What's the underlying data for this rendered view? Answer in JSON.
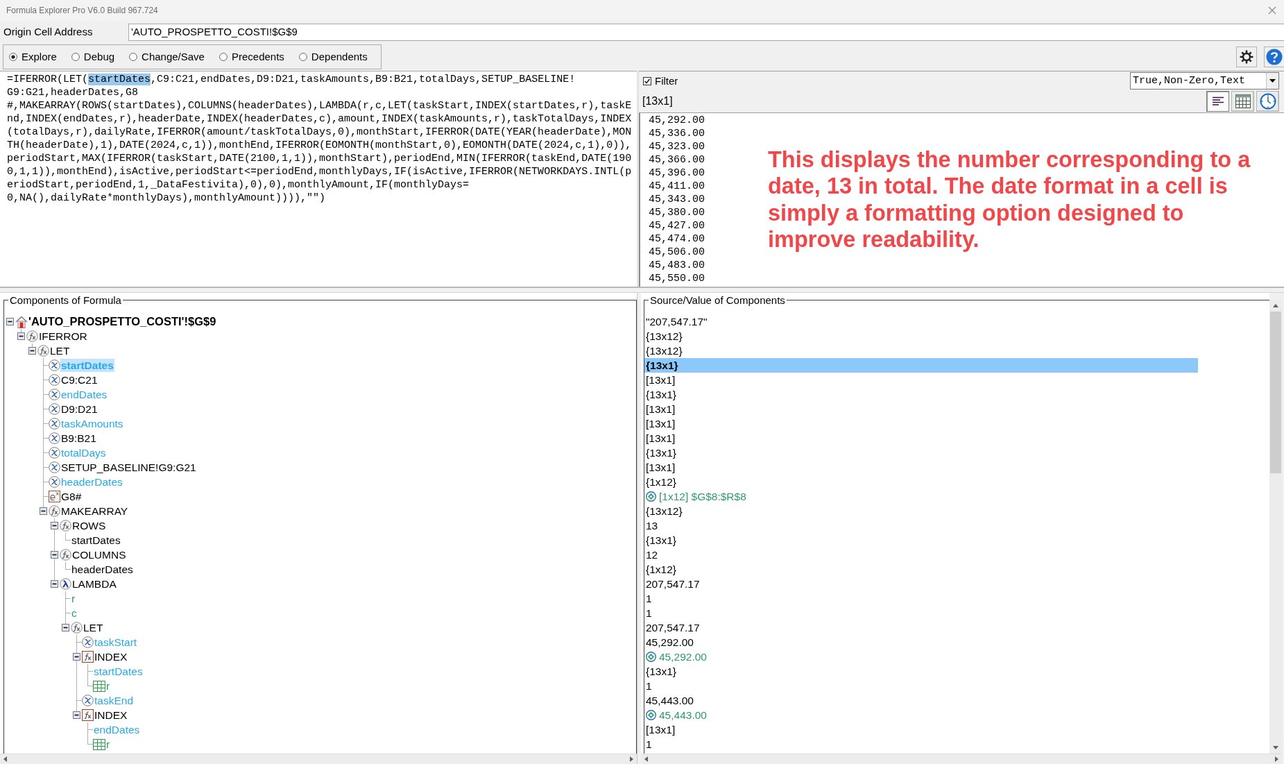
{
  "window": {
    "title": "Formula Explorer Pro V6.0 Build 967.724"
  },
  "origin": {
    "label": "Origin Cell Address",
    "value": "'AUTO_PROSPETTO_COSTI!$G$9"
  },
  "modes": [
    {
      "label": "Explore",
      "selected": true
    },
    {
      "label": "Debug",
      "selected": false
    },
    {
      "label": "Change/Save",
      "selected": false
    },
    {
      "label": "Precedents",
      "selected": false
    },
    {
      "label": "Dependents",
      "selected": false
    }
  ],
  "formula": {
    "lines": [
      {
        "segments": [
          {
            "text": "=IFERROR(LET(",
            "selected": false
          },
          {
            "text": "startDates",
            "selected": true
          },
          {
            "text": ",C9:C21,endDates,D9:D21,taskAmounts,B9:B21,totalDays,SETUP_BASELINE!",
            "selected": false
          }
        ]
      },
      {
        "segments": [
          {
            "text": "G9:G21,headerDates,G8",
            "selected": false
          }
        ]
      },
      {
        "segments": [
          {
            "text": "#,MAKEARRAY(ROWS(startDates),COLUMNS(headerDates),LAMBDA(r,c,LET(taskStart,INDEX(startDates,r),taskE",
            "selected": false
          }
        ]
      },
      {
        "segments": [
          {
            "text": "nd,INDEX(endDates,r),headerDate,INDEX(headerDates,c),amount,INDEX(taskAmounts,r),taskTotalDays,INDEX",
            "selected": false
          }
        ]
      },
      {
        "segments": [
          {
            "text": "(totalDays,r),dailyRate,IFERROR(amount/taskTotalDays,0),monthStart,IFERROR(DATE(YEAR(headerDate),MON",
            "selected": false
          }
        ]
      },
      {
        "segments": [
          {
            "text": "TH(headerDate),1),DATE(2024,c,1)),monthEnd,IFERROR(EOMONTH(monthStart,0),EOMONTH(DATE(2024,c,1),0)),",
            "selected": false
          }
        ]
      },
      {
        "segments": [
          {
            "text": "periodStart,MAX(IFERROR(taskStart,DATE(2100,1,1)),monthStart),periodEnd,MIN(IFERROR(taskEnd,DATE(190",
            "selected": false
          }
        ]
      },
      {
        "segments": [
          {
            "text": "0,1,1)),monthEnd),isActive,periodStart<=periodEnd,monthlyDays,IF(isActive,IFERROR(NETWORKDAYS.INTL(p",
            "selected": false
          }
        ]
      },
      {
        "segments": [
          {
            "text": "eriodStart,periodEnd,1,_DataFestivita),0),0),monthlyAmount,IF(monthlyDays=",
            "selected": false
          }
        ]
      },
      {
        "segments": [
          {
            "text": "0,NA(),dailyRate*monthlyDays),monthlyAmount)))),\"\")",
            "selected": false
          }
        ]
      }
    ]
  },
  "result": {
    "filter": {
      "label": "Filter",
      "checked": true
    },
    "dropdown": {
      "value": "True,Non-Zero,Text"
    },
    "size": "[13x1]",
    "view_buttons": [
      {
        "kind": "text",
        "pressed": true
      },
      {
        "kind": "grid",
        "pressed": false
      },
      {
        "kind": "clock",
        "pressed": false
      }
    ],
    "values": [
      "45,292.00",
      "45,336.00",
      "45,323.00",
      "45,366.00",
      "45,396.00",
      "45,411.00",
      "45,343.00",
      "45,380.00",
      "45,427.00",
      "45,474.00",
      "45,506.00",
      "45,483.00",
      "45,550.00"
    ],
    "annotation": "This displays the number corresponding to a date, 13 in total. The date format in a cell is simply a formatting option designed to improve readability."
  },
  "components": {
    "title": "Components of Formula",
    "tree": [
      {
        "label": "'AUTO_PROSPETTO_COSTI'!$G$9",
        "kind": "cell",
        "color": "#000000",
        "selected": false,
        "expanded": true,
        "children": [
          {
            "label": "IFERROR",
            "kind": "function",
            "color": "#000000",
            "selected": false,
            "expanded": true,
            "children": [
              {
                "label": "LET",
                "kind": "function",
                "color": "#000000",
                "selected": false,
                "expanded": true,
                "children": [
                  {
                    "label": "startDates",
                    "kind": "name",
                    "color": "#27aae8",
                    "selected": true
                  },
                  {
                    "label": "C9:C21",
                    "kind": "name",
                    "color": "#000000",
                    "selected": false
                  },
                  {
                    "label": "endDates",
                    "kind": "name",
                    "color": "#27aae8",
                    "selected": false
                  },
                  {
                    "label": "D9:D21",
                    "kind": "name",
                    "color": "#000000",
                    "selected": false
                  },
                  {
                    "label": "taskAmounts",
                    "kind": "name",
                    "color": "#27aae8",
                    "selected": false
                  },
                  {
                    "label": "B9:B21",
                    "kind": "name",
                    "color": "#000000",
                    "selected": false
                  },
                  {
                    "label": "totalDays",
                    "kind": "name",
                    "color": "#27aae8",
                    "selected": false
                  },
                  {
                    "label": "SETUP_BASELINE!G9:G21",
                    "kind": "name",
                    "color": "#000000",
                    "selected": false
                  },
                  {
                    "label": "headerDates",
                    "kind": "name",
                    "color": "#27aae8",
                    "selected": false
                  },
                  {
                    "label": "G8#",
                    "kind": "constant",
                    "color": "#000000",
                    "selected": false
                  },
                  {
                    "label": "MAKEARRAY",
                    "kind": "function",
                    "color": "#000000",
                    "selected": false,
                    "expanded": true,
                    "children": [
                      {
                        "label": "ROWS",
                        "kind": "function",
                        "color": "#000000",
                        "selected": false,
                        "expanded": true,
                        "children": [
                          {
                            "label": "startDates",
                            "kind": "plain",
                            "color": "#000000",
                            "selected": false
                          }
                        ]
                      },
                      {
                        "label": "COLUMNS",
                        "kind": "function",
                        "color": "#000000",
                        "selected": false,
                        "expanded": true,
                        "children": [
                          {
                            "label": "headerDates",
                            "kind": "plain",
                            "color": "#000000",
                            "selected": false
                          }
                        ]
                      },
                      {
                        "label": "LAMBDA",
                        "kind": "lambda",
                        "color": "#000000",
                        "selected": false,
                        "expanded": true,
                        "children": [
                          {
                            "label": "r",
                            "kind": "plain",
                            "color": "#21a353",
                            "selected": false
                          },
                          {
                            "label": "c",
                            "kind": "plain",
                            "color": "#21a353",
                            "selected": false
                          },
                          {
                            "label": "LET",
                            "kind": "function",
                            "color": "#000000",
                            "selected": false,
                            "expanded": true,
                            "children": [
                              {
                                "label": "taskStart",
                                "kind": "name",
                                "color": "#27aae8",
                                "selected": false
                              },
                              {
                                "label": "INDEX",
                                "kind": "function_box",
                                "color": "#000000",
                                "selected": false,
                                "expanded": true,
                                "children": [
                                  {
                                    "label": "startDates",
                                    "kind": "plain",
                                    "color": "#27aae8",
                                    "selected": false
                                  },
                                  {
                                    "label": "r",
                                    "kind": "range",
                                    "color": "#21a353",
                                    "selected": false
                                  }
                                ]
                              },
                              {
                                "label": "taskEnd",
                                "kind": "name",
                                "color": "#27aae8",
                                "selected": false
                              },
                              {
                                "label": "INDEX",
                                "kind": "function_box",
                                "color": "#000000",
                                "selected": false,
                                "expanded": true,
                                "children": [
                                  {
                                    "label": "endDates",
                                    "kind": "plain",
                                    "color": "#27aae8",
                                    "selected": false
                                  },
                                  {
                                    "label": "r",
                                    "kind": "range",
                                    "color": "#21a353",
                                    "selected": false
                                  }
                                ]
                              }
                            ]
                          }
                        ]
                      }
                    ]
                  }
                ]
              }
            ]
          }
        ]
      }
    ]
  },
  "sources": {
    "title": "Source/Value of Components",
    "items": [
      {
        "text": "\"207,547.17\"",
        "kind": "value",
        "selected": false
      },
      {
        "text": "{13x12}",
        "kind": "value",
        "selected": false
      },
      {
        "text": "{13x12}",
        "kind": "value",
        "selected": false
      },
      {
        "text": "{13x1}",
        "kind": "value",
        "selected": true
      },
      {
        "text": "[13x1]",
        "kind": "value",
        "selected": false
      },
      {
        "text": "{13x1}",
        "kind": "value",
        "selected": false
      },
      {
        "text": "[13x1]",
        "kind": "value",
        "selected": false
      },
      {
        "text": "[13x1]",
        "kind": "value",
        "selected": false
      },
      {
        "text": "[13x1]",
        "kind": "value",
        "selected": false
      },
      {
        "text": "{13x1}",
        "kind": "value",
        "selected": false
      },
      {
        "text": "[13x1]",
        "kind": "value",
        "selected": false
      },
      {
        "text": "{1x12}",
        "kind": "value",
        "selected": false
      },
      {
        "text": "[1x12] $G$8:$R$8",
        "kind": "link",
        "selected": false
      },
      {
        "text": "{13x12}",
        "kind": "value",
        "selected": false
      },
      {
        "text": "13",
        "kind": "value",
        "selected": false
      },
      {
        "text": "{13x1}",
        "kind": "value",
        "selected": false
      },
      {
        "text": "12",
        "kind": "value",
        "selected": false
      },
      {
        "text": "{1x12}",
        "kind": "value",
        "selected": false
      },
      {
        "text": "207,547.17",
        "kind": "value",
        "selected": false
      },
      {
        "text": "1",
        "kind": "value",
        "selected": false
      },
      {
        "text": "1",
        "kind": "value",
        "selected": false
      },
      {
        "text": "207,547.17",
        "kind": "value",
        "selected": false
      },
      {
        "text": "45,292.00",
        "kind": "value",
        "selected": false
      },
      {
        "text": "45,292.00",
        "kind": "link",
        "selected": false
      },
      {
        "text": "{13x1}",
        "kind": "value",
        "selected": false
      },
      {
        "text": "1",
        "kind": "value",
        "selected": false
      },
      {
        "text": "45,443.00",
        "kind": "value",
        "selected": false
      },
      {
        "text": "45,443.00",
        "kind": "link",
        "selected": false
      },
      {
        "text": "[13x1]",
        "kind": "value",
        "selected": false
      },
      {
        "text": "1",
        "kind": "value",
        "selected": false
      }
    ]
  }
}
